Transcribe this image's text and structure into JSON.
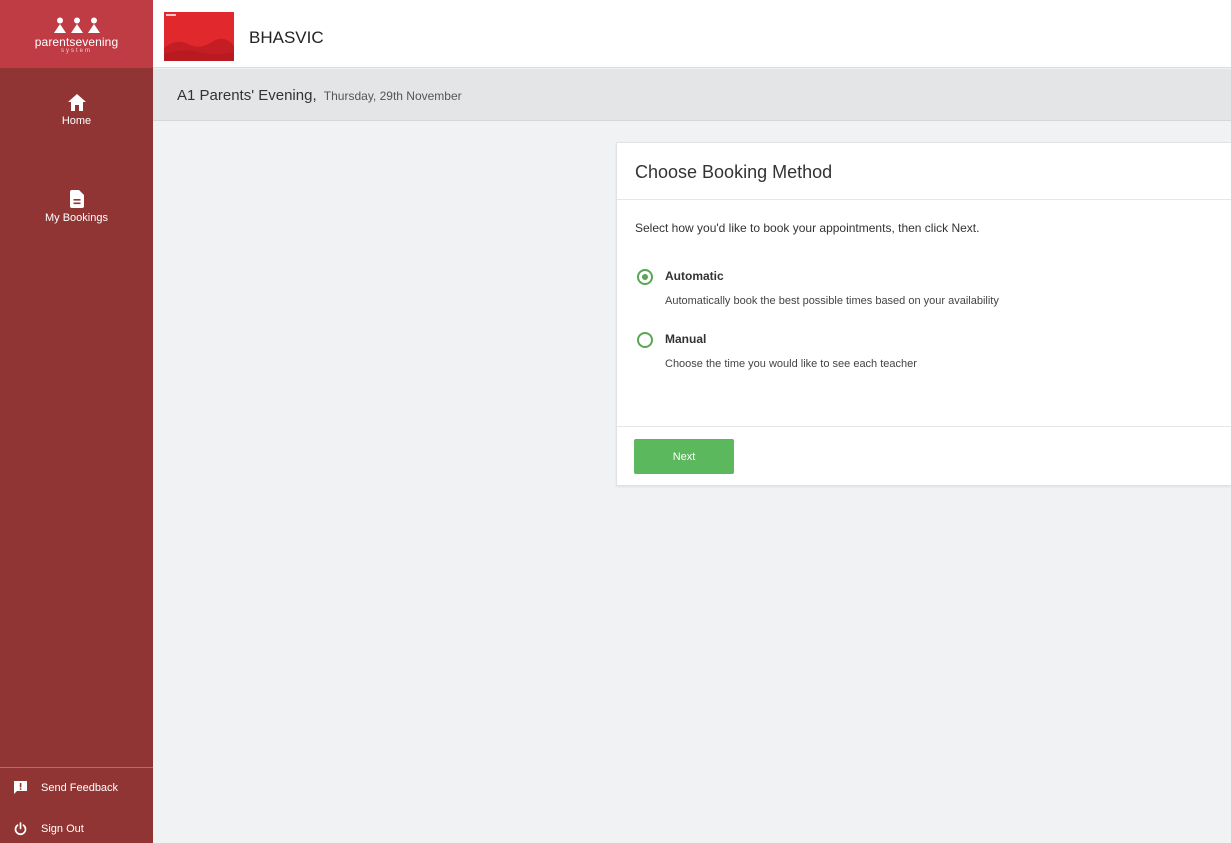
{
  "brand": {
    "logo_text": "parentsevening",
    "logo_subtext": "system",
    "school_name": "BHASVIC",
    "primary_color": "#913434",
    "logo_bg_color": "#bf3c44",
    "accent_green": "#5cb85c"
  },
  "sidebar": {
    "items": [
      {
        "label": "Home",
        "icon": "home-icon"
      },
      {
        "label": "My Bookings",
        "icon": "document-icon"
      }
    ],
    "footer": [
      {
        "label": "Send Feedback",
        "icon": "feedback-icon"
      },
      {
        "label": "Sign Out",
        "icon": "power-icon"
      }
    ]
  },
  "event": {
    "title": "A1 Parents' Evening,",
    "date": "Thursday, 29th November"
  },
  "booking": {
    "title": "Choose Booking Method",
    "instruction": "Select how you'd like to book your appointments, then click Next.",
    "options": [
      {
        "label": "Automatic",
        "description": "Automatically book the best possible times based on your availability",
        "selected": true
      },
      {
        "label": "Manual",
        "description": "Choose the time you would like to see each teacher",
        "selected": false
      }
    ],
    "next_label": "Next"
  }
}
